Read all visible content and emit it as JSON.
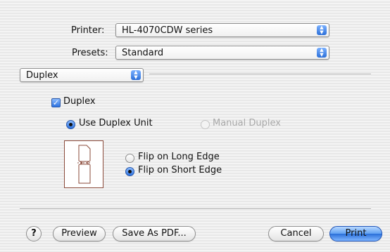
{
  "printer": {
    "label": "Printer:",
    "value": "HL-4070CDW series"
  },
  "presets": {
    "label": "Presets:",
    "value": "Standard"
  },
  "panel": {
    "value": "Duplex"
  },
  "duplex": {
    "checkbox_label": "Duplex",
    "checked": true,
    "use_duplex_unit": "Use Duplex Unit",
    "manual_duplex": "Manual Duplex",
    "flip_long_edge": "Flip on Long Edge",
    "flip_short_edge": "Flip on Short Edge"
  },
  "buttons": {
    "help": "?",
    "preview": "Preview",
    "save_pdf": "Save As PDF...",
    "cancel": "Cancel",
    "print": "Print"
  },
  "icons": {
    "popup_arrows": "up-down-arrows-icon",
    "help": "question-mark-icon",
    "illustration": "duplex-flip-short-edge-icon"
  },
  "colors": {
    "accent_blue": "#2d72e0",
    "illustration_border": "#8a4a3a"
  }
}
